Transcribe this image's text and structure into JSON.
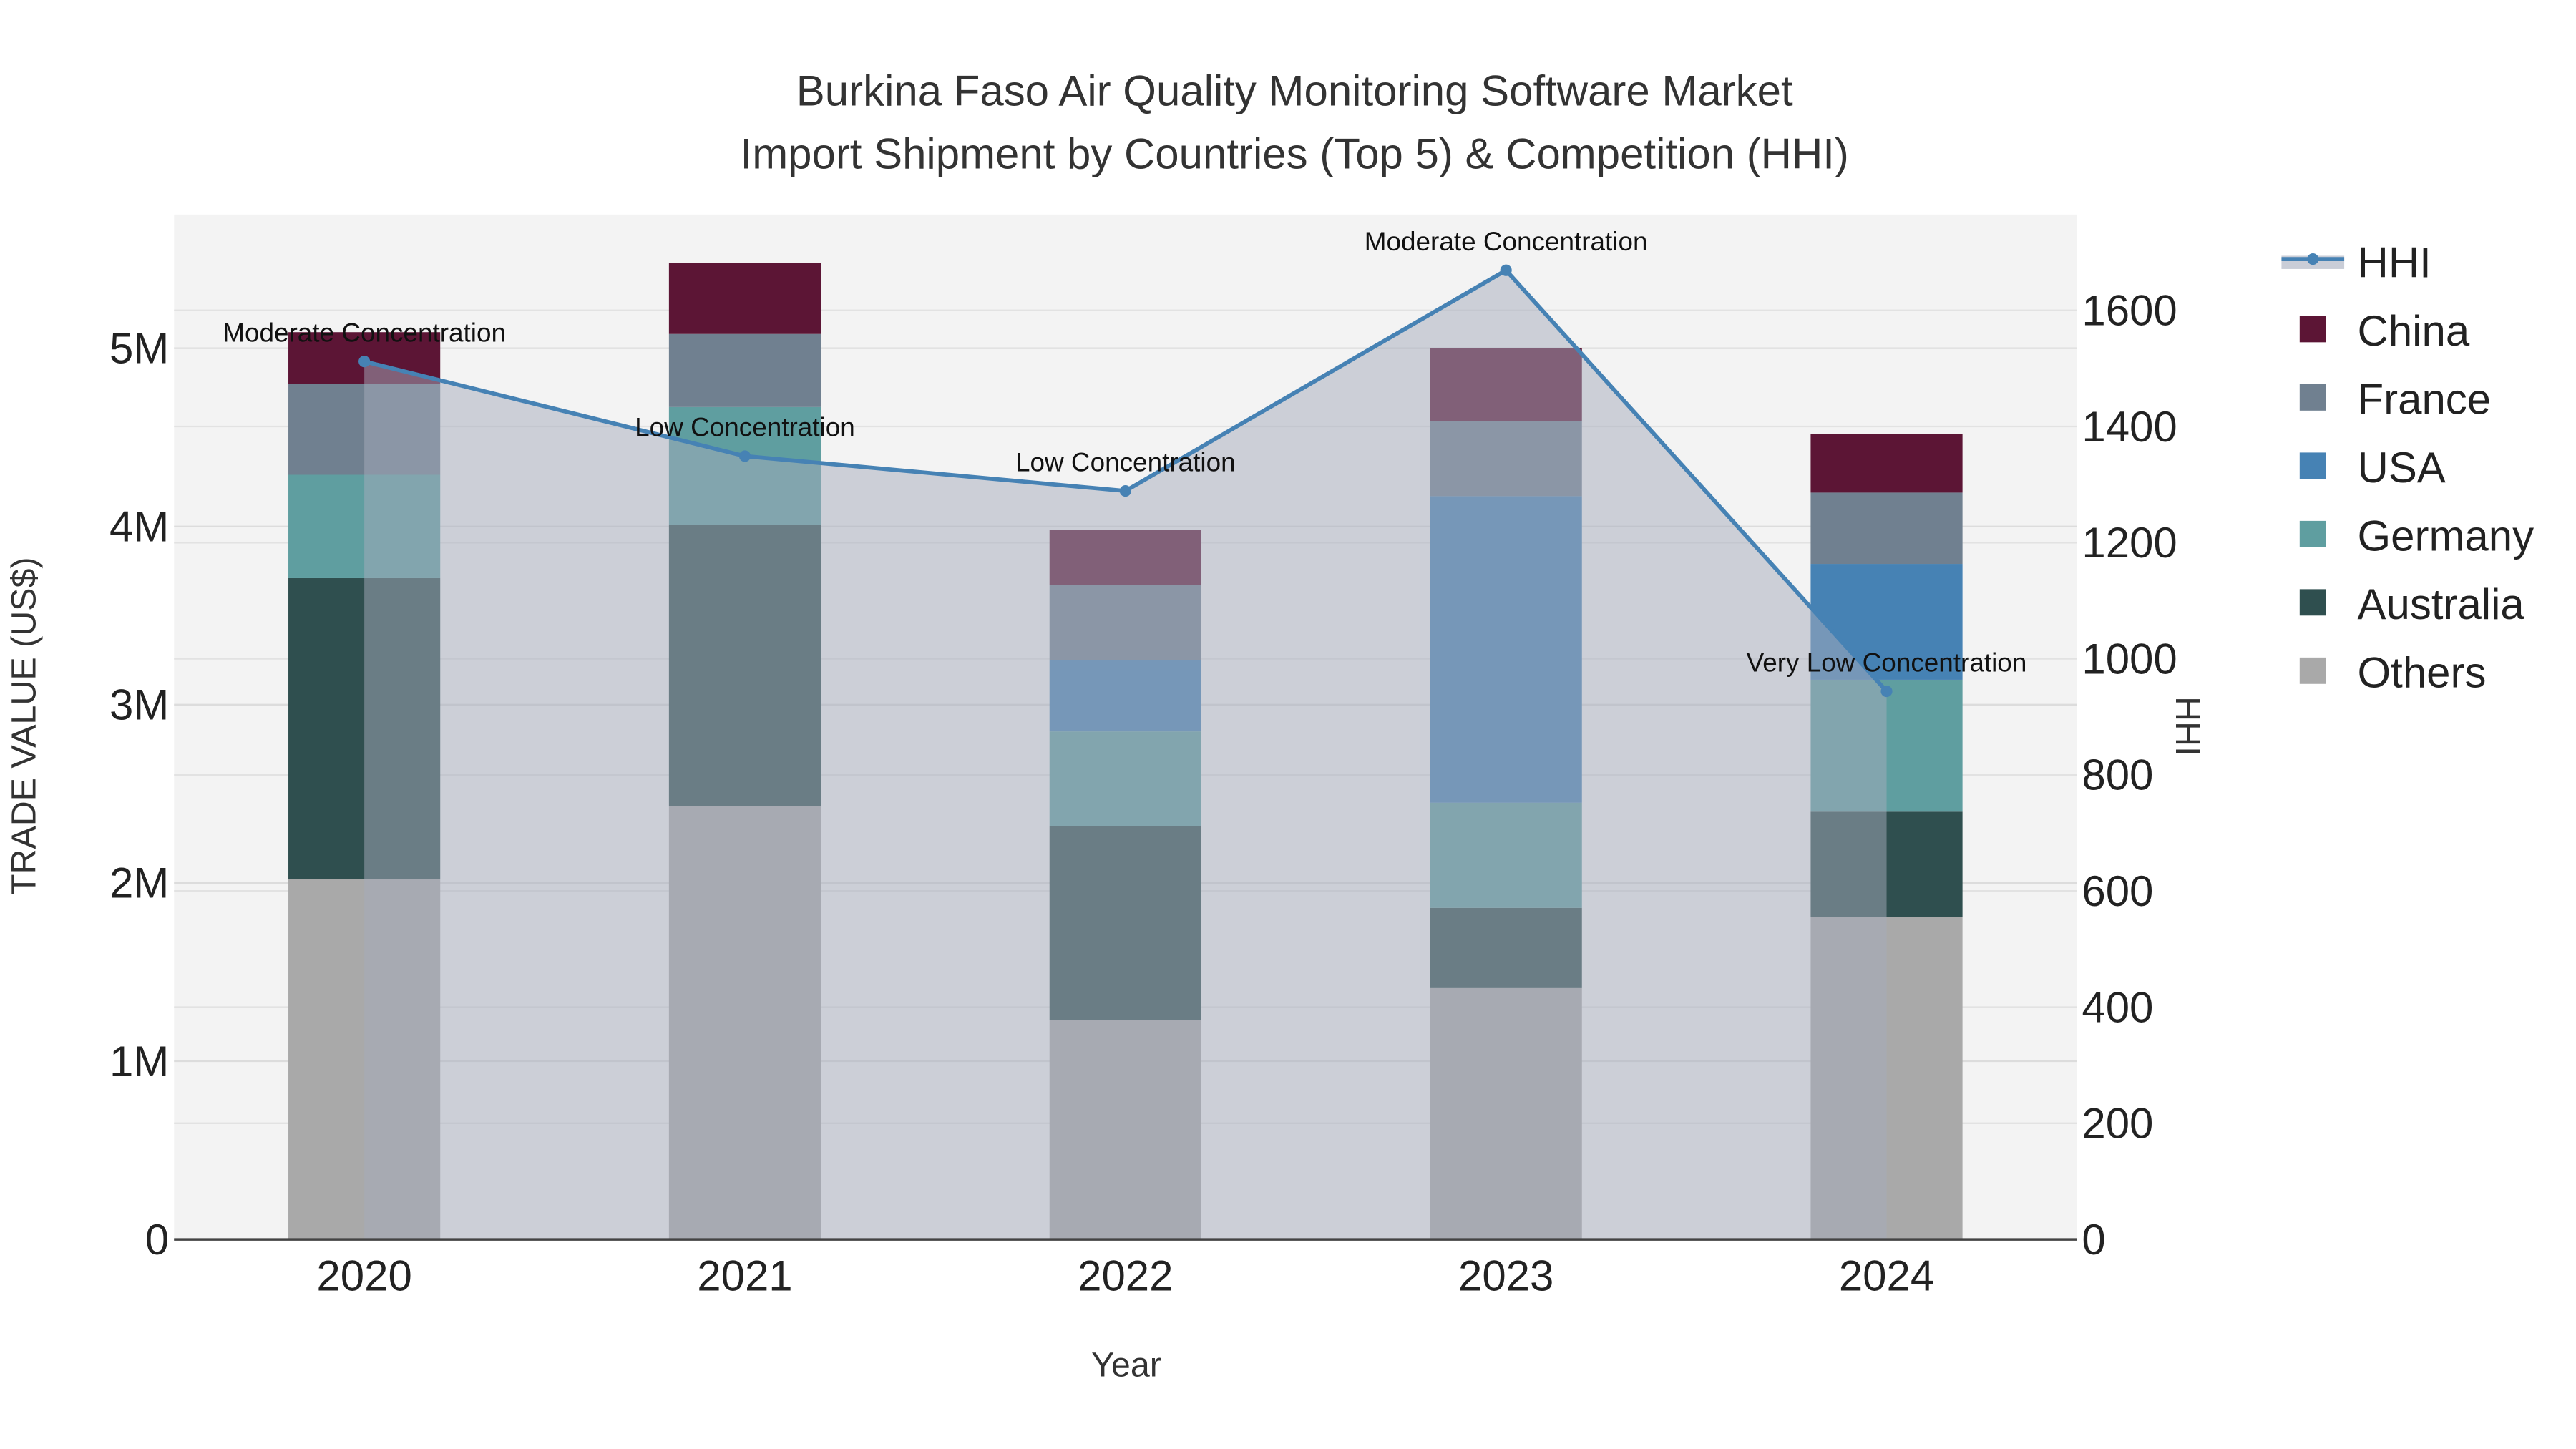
{
  "chart_data": {
    "type": "bar",
    "stacked": true,
    "title_line1": "Burkina Faso Air Quality Monitoring Software Market",
    "title_line2": "Import Shipment by Countries (Top 5) & Competition (HHI)",
    "xlabel": "Year",
    "ylabel": "TRADE VALUE (US$)",
    "y2label": "HHI",
    "categories": [
      "2020",
      "2021",
      "2022",
      "2023",
      "2024"
    ],
    "ylim": [
      0,
      5750000
    ],
    "y2lim": [
      0,
      1765
    ],
    "yticks": [
      0,
      1000000,
      2000000,
      3000000,
      4000000,
      5000000
    ],
    "ytick_labels": [
      "0",
      "1M",
      "2M",
      "3M",
      "4M",
      "5M"
    ],
    "y2ticks": [
      0,
      200,
      400,
      600,
      800,
      1000,
      1200,
      1400,
      1600
    ],
    "y2tick_labels": [
      "0",
      "200",
      "400",
      "600",
      "800",
      "1000",
      "1200",
      "1400",
      "1600"
    ],
    "series": [
      {
        "name": "Others",
        "color": "#a9a9a9",
        "values": [
          2020000,
          2430000,
          1230000,
          1410000,
          1810000
        ]
      },
      {
        "name": "Australia",
        "color": "#2f4f4f",
        "values": [
          1690000,
          1580000,
          1090000,
          450000,
          590000
        ]
      },
      {
        "name": "Germany",
        "color": "#5f9ea0",
        "values": [
          580000,
          660000,
          530000,
          590000,
          740000
        ]
      },
      {
        "name": "USA",
        "color": "#4682b4",
        "values": [
          null,
          null,
          400000,
          1720000,
          650000
        ]
      },
      {
        "name": "France",
        "color": "#708090",
        "values": [
          510000,
          410000,
          420000,
          420000,
          400000
        ]
      },
      {
        "name": "China",
        "color": "#5c1535",
        "values": [
          290000,
          400000,
          310000,
          410000,
          330000
        ]
      }
    ],
    "hhi": {
      "name": "HHI",
      "color": "#4682b4",
      "values": [
        1512,
        1349,
        1289,
        1669,
        944
      ],
      "annotations": [
        "Moderate Concentration",
        "Low Concentration",
        "Low Concentration",
        "Moderate Concentration",
        "Very Low Concentration"
      ]
    },
    "legend": [
      "HHI",
      "China",
      "France",
      "USA",
      "Germany",
      "Australia",
      "Others"
    ],
    "legend_position": "right",
    "grid": true
  }
}
